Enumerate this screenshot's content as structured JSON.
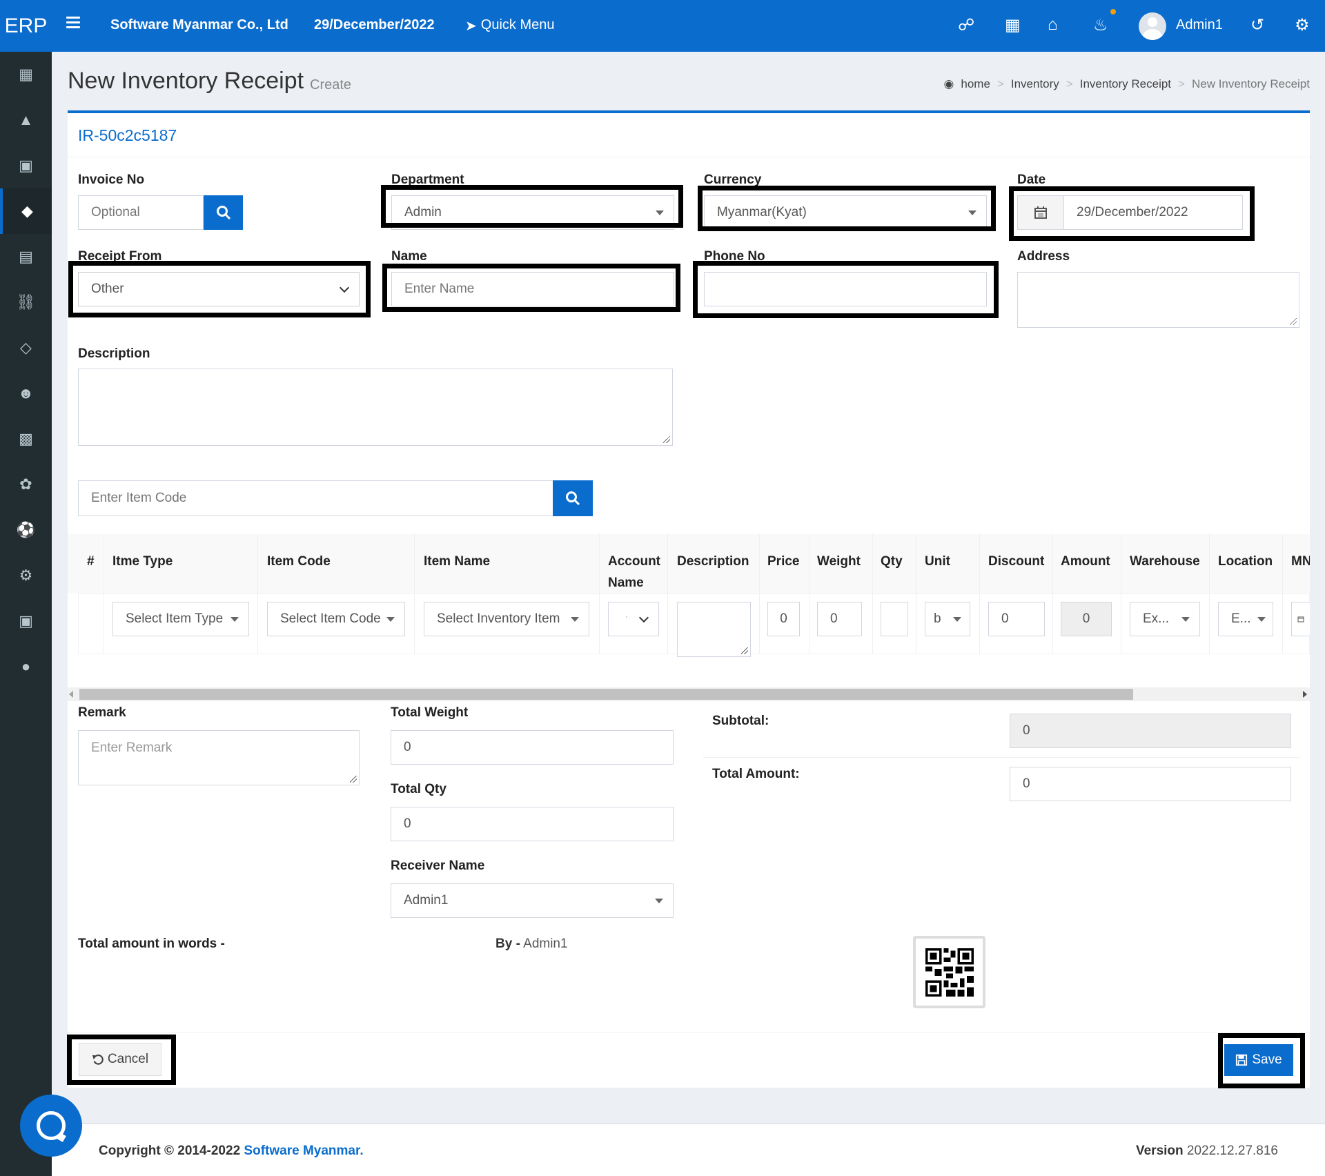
{
  "header": {
    "logo": "ERP",
    "company": "Software Myanmar Co., Ltd",
    "date": "29/December/2022",
    "quick_menu": "Quick Menu",
    "user": "Admin1"
  },
  "page": {
    "title": "New Inventory Receipt",
    "subtitle": "Create",
    "breadcrumb": [
      "home",
      "Inventory",
      "Inventory Receipt",
      "New Inventory Receipt"
    ],
    "doc_no": "IR-50c2c5187"
  },
  "form": {
    "invoice_no": {
      "label": "Invoice No",
      "placeholder": "Optional"
    },
    "department": {
      "label": "Department",
      "value": "Admin"
    },
    "currency": {
      "label": "Currency",
      "value": "Myanmar(Kyat)"
    },
    "date": {
      "label": "Date",
      "value": "29/December/2022"
    },
    "receipt_from": {
      "label": "Receipt From",
      "value": "Other"
    },
    "name": {
      "label": "Name",
      "placeholder": "Enter Name"
    },
    "phone": {
      "label": "Phone No",
      "value": ""
    },
    "address": {
      "label": "Address",
      "value": ""
    },
    "description": {
      "label": "Description",
      "value": ""
    },
    "item_code_search": {
      "placeholder": "Enter Item Code"
    }
  },
  "table": {
    "headers": {
      "num": "#",
      "item_type": "Itme Type",
      "item_code": "Item Code",
      "item_name": "Item Name",
      "account_name_1": "Account",
      "account_name_2": "Name",
      "description": "Description",
      "price": "Price",
      "weight": "Weight",
      "qty": "Qty",
      "unit": "Unit",
      "discount": "Discount",
      "amount": "Amount",
      "warehouse": "Warehouse",
      "location": "Location",
      "mni": "MNI"
    },
    "row": {
      "item_type": "Select Item Type",
      "item_code": "Select Item Code",
      "item_name": "Select Inventory Item",
      "account": "'",
      "price": "0",
      "weight": "0",
      "qty": "",
      "unit": "b",
      "discount": "0",
      "amount": "0",
      "warehouse": "Ex...",
      "location": "E..."
    }
  },
  "summary": {
    "remark": {
      "label": "Remark",
      "placeholder": "Enter Remark"
    },
    "total_weight": {
      "label": "Total Weight",
      "value": "0"
    },
    "total_qty": {
      "label": "Total Qty",
      "value": "0"
    },
    "receiver_name": {
      "label": "Receiver Name",
      "value": "Admin1"
    },
    "subtotal": {
      "label": "Subtotal:",
      "value": "0"
    },
    "total_amount": {
      "label": "Total Amount:",
      "value": "0"
    },
    "amount_in_words": "Total amount in words -",
    "by_label": "By -",
    "by_value": "Admin1"
  },
  "buttons": {
    "cancel": "Cancel",
    "save": "Save"
  },
  "footer": {
    "copyright": "Copyright © 2014-2022",
    "brand": "Software Myanmar.",
    "version_label": "Version",
    "version": "2022.12.27.816"
  },
  "colors": {
    "primary": "#0a6ccd",
    "sidebar": "#222d32",
    "background": "#ecf0f5"
  },
  "icons": {
    "topbar": [
      "menu-icon",
      "rocket-icon",
      "wechat-icon",
      "building-icon",
      "home-icon",
      "bell-icon",
      "history-icon",
      "gear-icon"
    ],
    "sidebar": [
      "calculator-icon",
      "chart-area-icon",
      "credit-card-icon",
      "cube-icon",
      "clipboard-icon",
      "cart-icon",
      "diamond-icon",
      "users-icon",
      "bar-chart-icon",
      "leaf-icon",
      "soccer-icon",
      "cog-icon",
      "book-icon",
      "comment-icon"
    ]
  }
}
